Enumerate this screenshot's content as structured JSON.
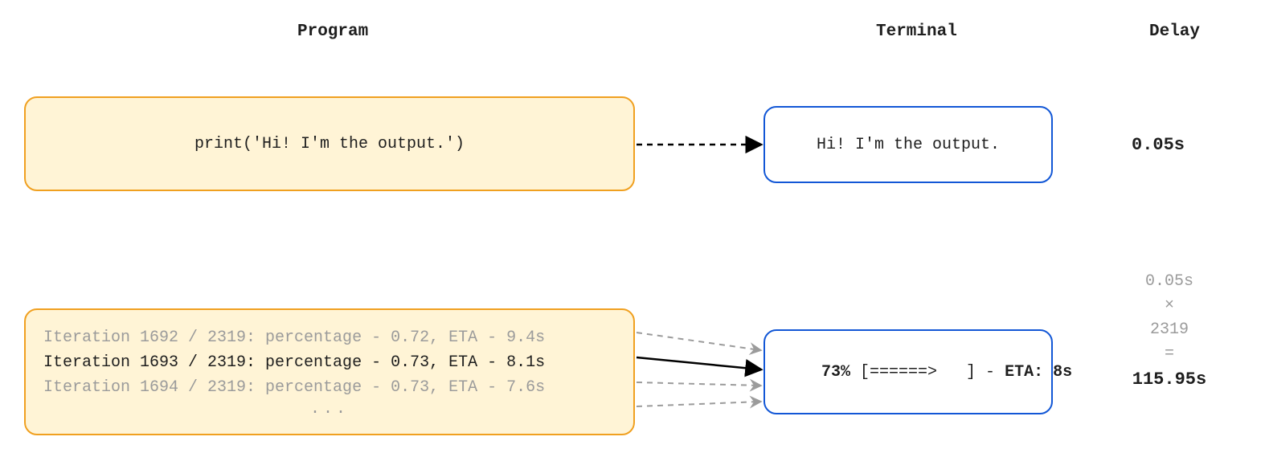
{
  "headers": {
    "program": "Program",
    "terminal": "Terminal",
    "delay": "Delay"
  },
  "row1": {
    "program_code": "print('Hi! I'm the output.')",
    "terminal_out": "Hi! I'm the output.",
    "delay": "0.05s"
  },
  "row2": {
    "program_lines": {
      "l1": "Iteration 1692 / 2319: percentage - 0.72, ETA - 9.4s",
      "l2": "Iteration 1693 / 2319: percentage - 0.73, ETA - 8.1s",
      "l3": "Iteration 1694 / 2319: percentage - 0.73, ETA - 7.6s",
      "ellipsis": "..."
    },
    "terminal_out_pct": "73%",
    "terminal_out_bar": " [======>   ] - ",
    "terminal_out_eta": "ETA: 8s",
    "calc": {
      "a": "0.05s",
      "op1": "×",
      "b": "2319",
      "op2": "=",
      "result": "115.95s"
    }
  }
}
